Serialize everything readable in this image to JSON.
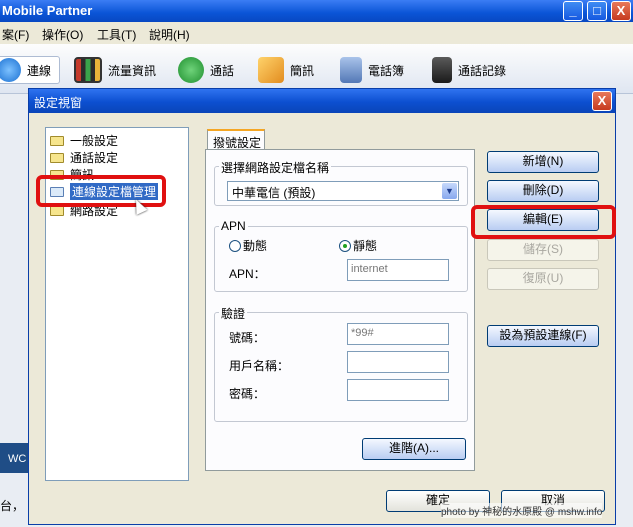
{
  "app": {
    "title": "Mobile Partner",
    "min_glyph": "_",
    "max_glyph": "□",
    "close_glyph": "X"
  },
  "menu": {
    "items": [
      "案(F)",
      "操作(O)",
      "工具(T)",
      "說明(H)"
    ]
  },
  "toolbar": {
    "items": [
      {
        "label": "連線",
        "icon": "connect-icon"
      },
      {
        "label": "流量資訊",
        "icon": "traffic-chart-icon"
      },
      {
        "label": "通話",
        "icon": "phone-icon"
      },
      {
        "label": "簡訊",
        "icon": "envelope-icon"
      },
      {
        "label": "電話簿",
        "icon": "contacts-icon"
      },
      {
        "label": "通話記錄",
        "icon": "call-log-icon"
      }
    ]
  },
  "background": {
    "strip_text": "WC",
    "bottom_text": "台，"
  },
  "dialog": {
    "title": "設定視窗",
    "close_glyph": "X",
    "tree": {
      "items": [
        {
          "label": "一般設定",
          "selected": false
        },
        {
          "label": "通話設定",
          "selected": false
        },
        {
          "label": "簡訊",
          "selected": false
        },
        {
          "label": "連線設定檔管理",
          "selected": true
        },
        {
          "label": "網路設定",
          "selected": false
        }
      ]
    },
    "tab": {
      "label": "撥號設定"
    },
    "profile_group": {
      "label": "選擇網路設定檔名稱",
      "selected_profile": "中華電信 (預設)",
      "dropdown_glyph": "▼"
    },
    "apn_group": {
      "label": "APN",
      "option_dynamic": "動態",
      "option_static": "靜態",
      "selected": "static",
      "apn_label": "APN：",
      "apn_value": "internet"
    },
    "auth_group": {
      "label": "驗證",
      "number_label": "號碼：",
      "number_value": "*99#",
      "username_label": "用戶名稱：",
      "username_value": "",
      "password_label": "密碼：",
      "password_value": ""
    },
    "buttons": {
      "new": "新增(N)",
      "delete": "刪除(D)",
      "edit": "編輯(E)",
      "save": "儲存(S)",
      "restore": "復原(U)",
      "set_default": "設為預設連線(F)",
      "advanced": "進階(A)...",
      "ok": "確定",
      "cancel": "取消"
    },
    "credit": "photo by 神秘的水原殿 @ mshw.info"
  }
}
